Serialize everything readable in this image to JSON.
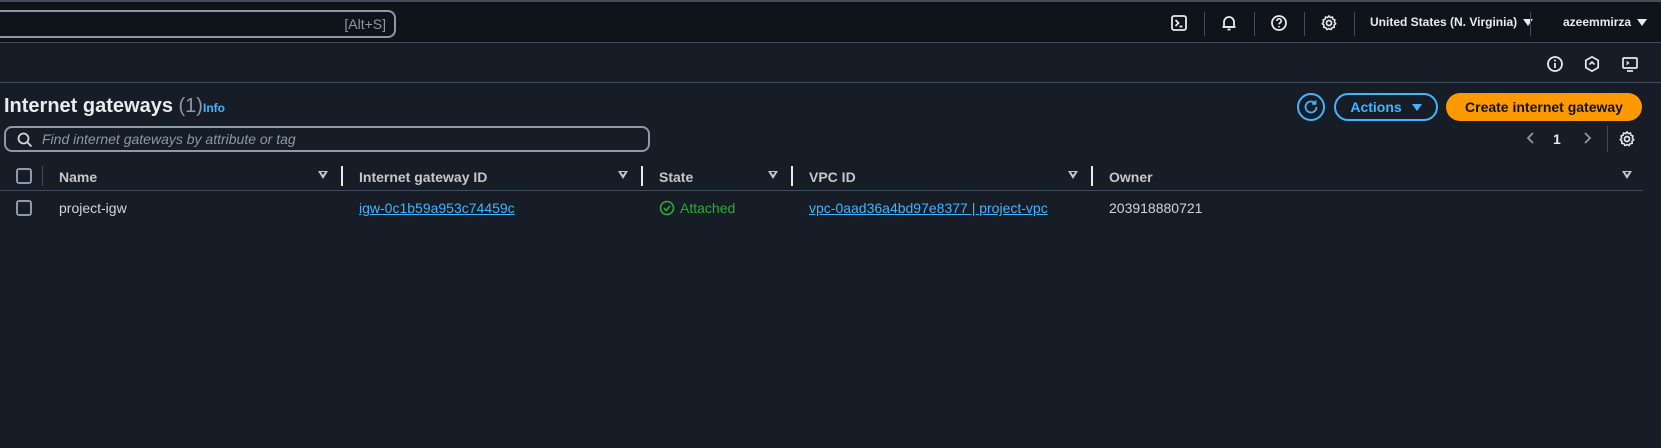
{
  "topbar": {
    "search_shortcut": "[Alt+S]",
    "region": "United States (N. Virginia)",
    "user": "azeemmirza",
    "icons": [
      "cloudshell-icon",
      "bell-icon",
      "help-icon",
      "gear-icon"
    ]
  },
  "subbar": {
    "icons": [
      "info-circle-icon",
      "hexagon-icon",
      "monitor-icon"
    ]
  },
  "page": {
    "title": "Internet gateways",
    "count": "(1)",
    "info_link": "Info",
    "actions_label": "Actions",
    "create_label": "Create internet gateway",
    "filter_placeholder": "Find internet gateways by attribute or tag",
    "page_number": "1"
  },
  "table": {
    "columns": [
      "Name",
      "Internet gateway ID",
      "State",
      "VPC ID",
      "Owner"
    ],
    "rows": [
      {
        "name": "project-igw",
        "igw_id": "igw-0c1b59a953c74459c",
        "state": "Attached",
        "vpc_id": "vpc-0aad36a4bd97e8377 | project-vpc",
        "owner": "203918880721"
      }
    ]
  },
  "colors": {
    "background": "#161d26",
    "topbar": "#0f141a",
    "link": "#42b4ff",
    "primary": "#ff9900",
    "success": "#29ad32"
  }
}
